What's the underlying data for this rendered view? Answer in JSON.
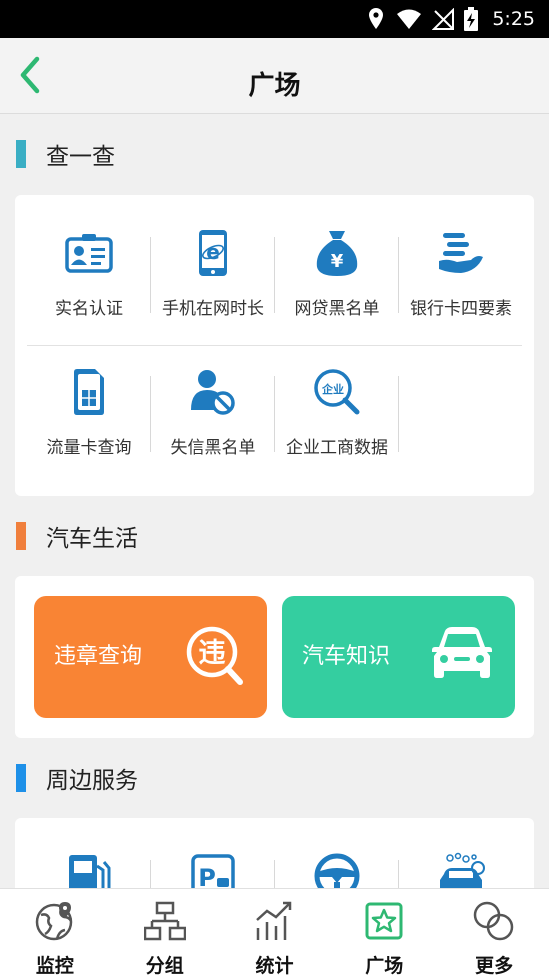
{
  "status_bar": {
    "time": "5:25",
    "icons": [
      "location-icon",
      "wifi-icon",
      "no-signal-icon",
      "battery-charging-icon"
    ]
  },
  "header": {
    "back_icon": "chevron-left-icon",
    "title": "广场"
  },
  "colors": {
    "accent_green": "#2eb872",
    "teal": "#3aaec4",
    "orange": "#f07f3c",
    "blue": "#1e90e8",
    "query_orange": "#f98434",
    "car_green": "#34cea0",
    "icon_blue": "#1f7bbf"
  },
  "sections": {
    "check": {
      "title": "查一查",
      "items": [
        {
          "label": "实名认证",
          "icon": "id-card-icon"
        },
        {
          "label": "手机在网时长",
          "icon": "mobile-ie-icon"
        },
        {
          "label": "网贷黑名单",
          "icon": "money-bag-icon"
        },
        {
          "label": "银行卡四要素",
          "icon": "hand-card-icon"
        },
        {
          "label": "流量卡查询",
          "icon": "sim-card-icon"
        },
        {
          "label": "失信黑名单",
          "icon": "user-blocked-icon"
        },
        {
          "label": "企业工商数据",
          "icon": "enterprise-search-icon"
        }
      ],
      "enterprise_badge": "企业"
    },
    "car": {
      "title": "汽车生活",
      "violation": {
        "label": "违章查询",
        "icon": "violation-search-icon",
        "glyph": "违"
      },
      "knowledge": {
        "label": "汽车知识",
        "icon": "car-icon"
      }
    },
    "nearby": {
      "title": "周边服务",
      "items": [
        {
          "icon": "gas-station-icon"
        },
        {
          "icon": "parking-icon"
        },
        {
          "icon": "steering-wheel-icon"
        },
        {
          "icon": "car-wash-icon"
        }
      ]
    }
  },
  "tabbar": {
    "tabs": [
      {
        "label": "监控",
        "icon": "globe-icon"
      },
      {
        "label": "分组",
        "icon": "org-chart-icon"
      },
      {
        "label": "统计",
        "icon": "stats-icon"
      },
      {
        "label": "广场",
        "icon": "square-star-icon"
      },
      {
        "label": "更多",
        "icon": "circles-icon"
      }
    ],
    "active": "广场"
  }
}
